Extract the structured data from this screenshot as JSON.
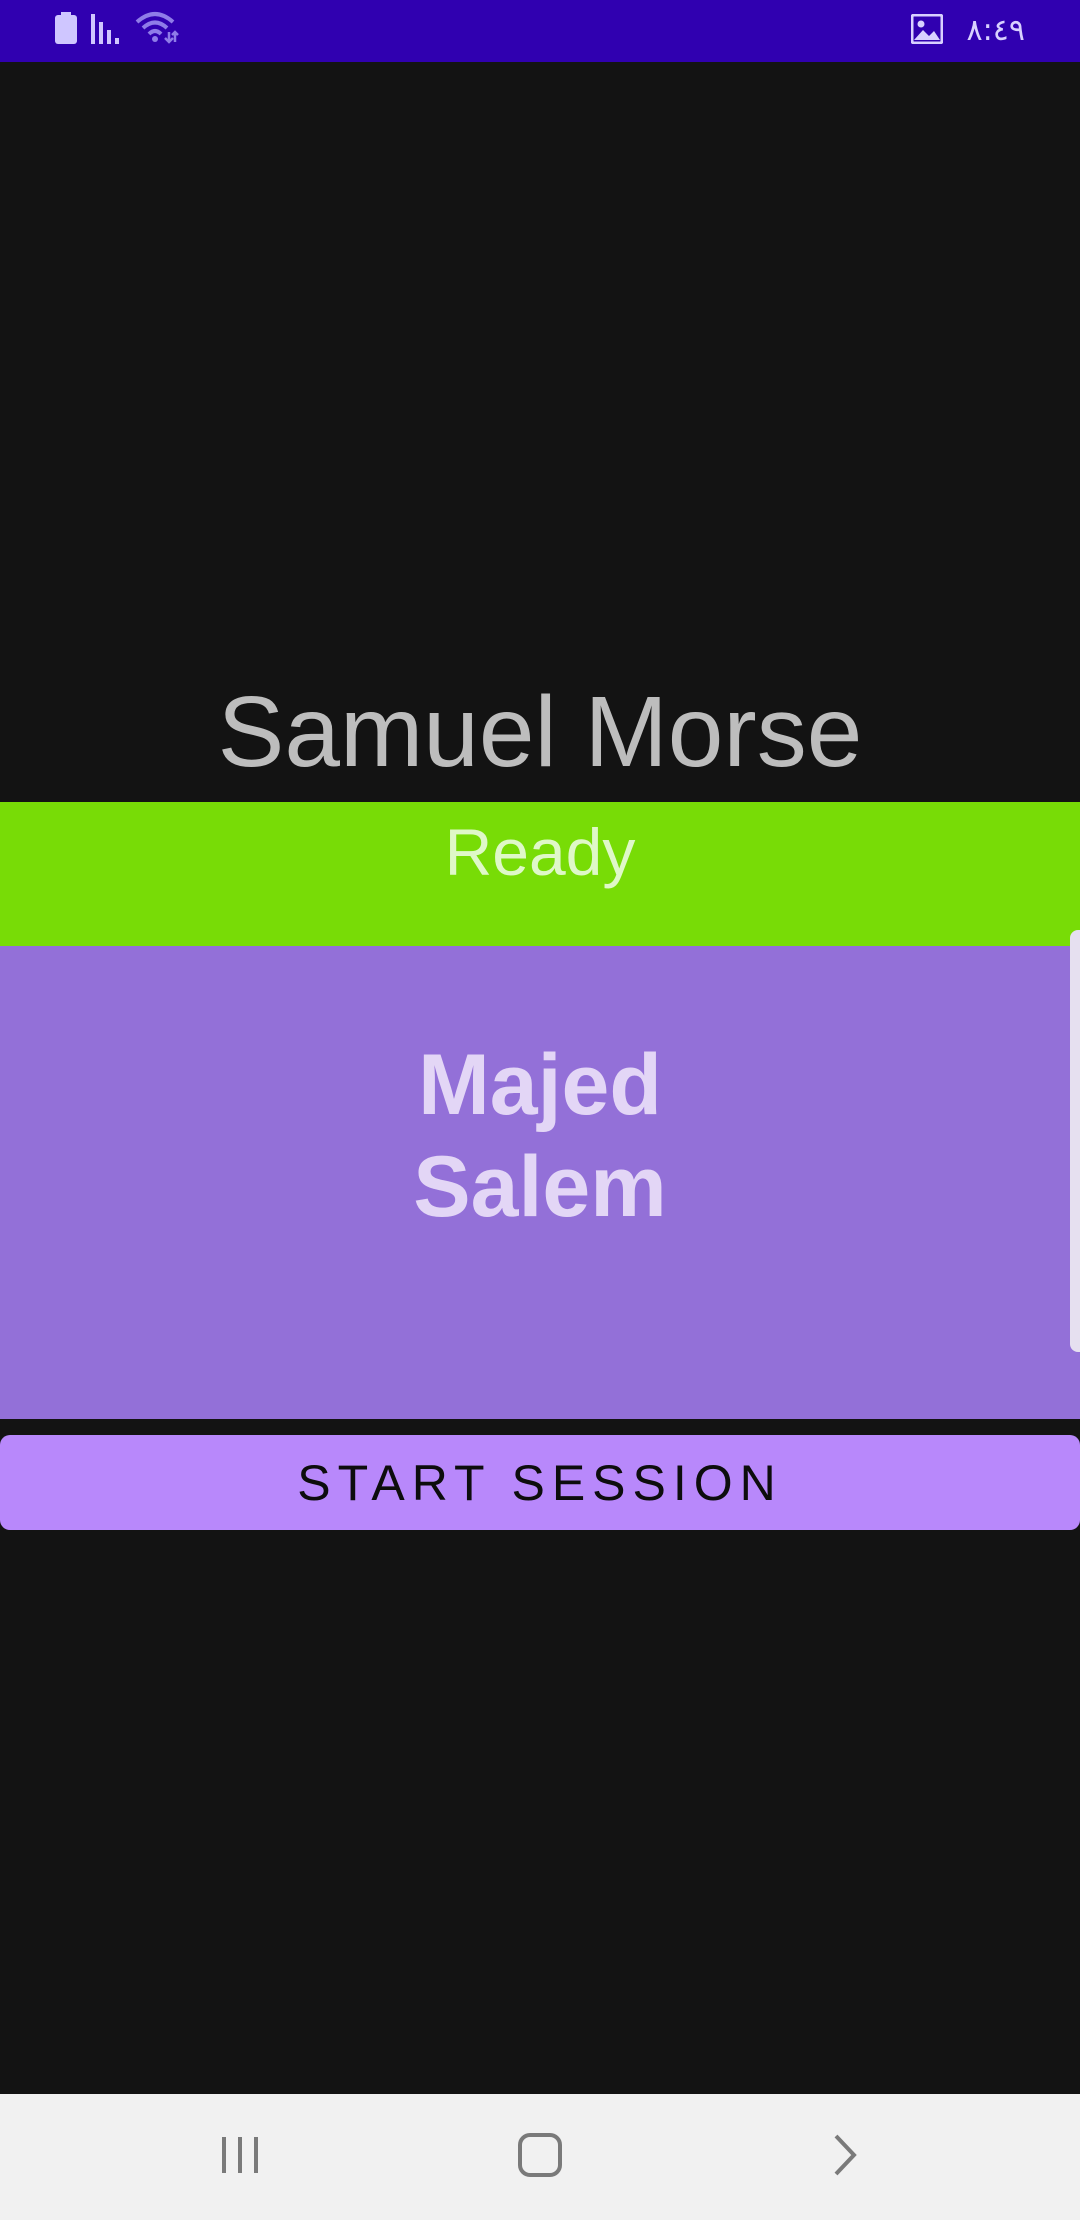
{
  "status_bar": {
    "time": "٨:٤٩",
    "icons": [
      "battery-icon",
      "signal-icon",
      "wifi-icon",
      "gallery-notification-icon"
    ]
  },
  "app": {
    "title": "Samuel Morse"
  },
  "status_banner": {
    "text": "Ready"
  },
  "partner": {
    "name": "Majed\nSalem"
  },
  "actions": {
    "start_label": "START SESSION"
  },
  "nav_bar": {
    "buttons": [
      "recent-apps-icon",
      "home-icon",
      "back-icon"
    ]
  },
  "colors": {
    "status_bar": "#3000B0",
    "background": "#131313",
    "ready_banner": "#78DC06",
    "partner_panel": "#9370D8",
    "start_button": "#B888FB",
    "nav_bar": "#F1F1F1"
  }
}
